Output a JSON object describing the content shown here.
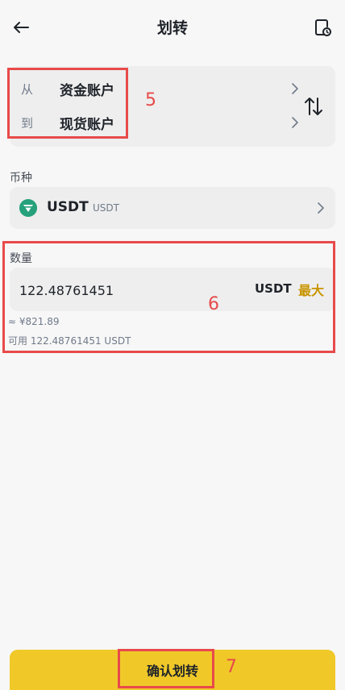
{
  "header": {
    "title": "划转",
    "back_icon": "arrow-left-icon",
    "history_icon": "record-clock-icon"
  },
  "accounts": {
    "from_prefix": "从",
    "from_name": "资金账户",
    "to_prefix": "到",
    "to_name": "现货账户",
    "swap_icon": "swap-vertical-icon"
  },
  "coin": {
    "label": "币种",
    "name": "USDT",
    "sub": "USDT",
    "icon": "tether-icon"
  },
  "amount": {
    "label": "数量",
    "value": "122.48761451",
    "unit": "USDT",
    "max_label": "最大",
    "fiat_estimate": "≈ ¥821.89",
    "available": "可用 122.48761451 USDT"
  },
  "confirm": {
    "label": "确认划转"
  },
  "annotations": {
    "box1": "5",
    "box2": "6",
    "box3": "7"
  },
  "colors": {
    "accent": "#f0c929",
    "max_text": "#c99400",
    "annotation": "#e84a4a",
    "tether": "#26a17b"
  }
}
